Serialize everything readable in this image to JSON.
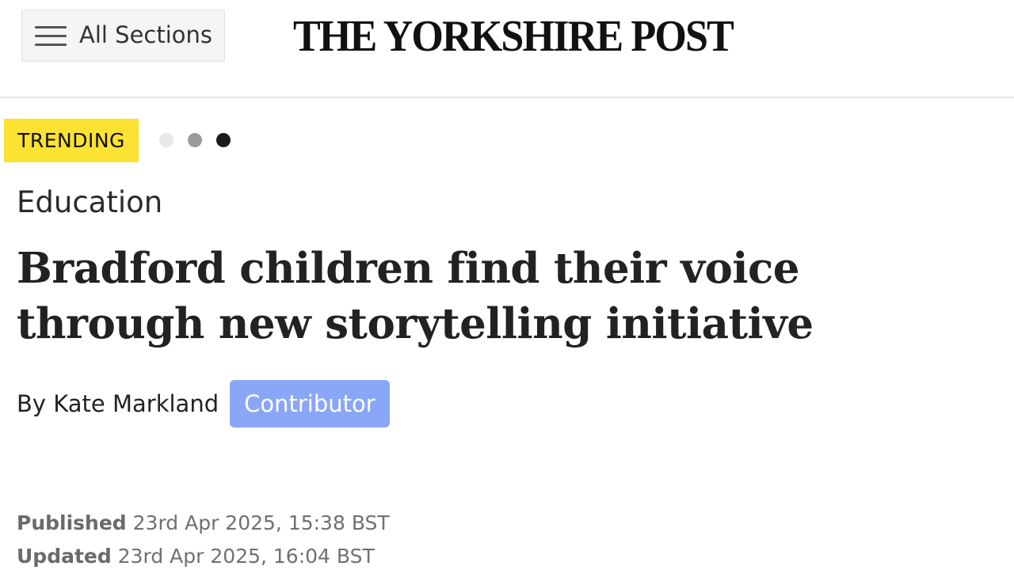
{
  "header": {
    "menu_label": "All Sections",
    "logo_text": "THE YORKSHIRE POST"
  },
  "trending": {
    "label": "TRENDING",
    "dots": 3,
    "active_dot": 3
  },
  "article": {
    "category": "Education",
    "headline": "Bradford children find their voice through new storytelling initiative",
    "byline_prefix": "By Kate Markland",
    "author_role": "Contributor",
    "published_label": "Published",
    "published_date": "23rd Apr 2025, 15:38 BST",
    "updated_label": "Updated",
    "updated_date": "23rd Apr 2025, 16:04 BST"
  },
  "colors": {
    "trending_badge": "#fbe233",
    "contributor_badge": "#8aa6f7",
    "text": "#222222",
    "meta_text": "#707070"
  }
}
